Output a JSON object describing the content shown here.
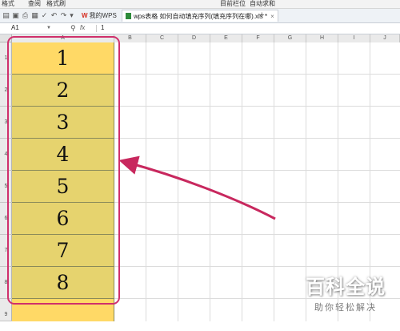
{
  "ribbon": {
    "items": [
      "格式",
      "查阅",
      "格式刷",
      "目前栏位",
      "自动求和"
    ]
  },
  "tabs": [
    {
      "label": "我的WPS",
      "active": false
    },
    {
      "label": "wps表格 如何自动填充序列(填充序列在哪).xls *",
      "active": true
    }
  ],
  "formula_bar": {
    "name_box": "A1",
    "fx_label": "fx",
    "value": "1"
  },
  "columns": [
    "A",
    "B",
    "C",
    "D",
    "E",
    "F",
    "G",
    "H",
    "I",
    "J"
  ],
  "rows": [
    "1",
    "2",
    "3",
    "4",
    "5",
    "6",
    "7",
    "8",
    "9"
  ],
  "cells": [
    "1",
    "2",
    "3",
    "4",
    "5",
    "6",
    "7",
    "8"
  ],
  "colors": {
    "active_cell": "#ffd966",
    "selected_cells": "#e6d36e",
    "highlight_outline": "#d0306c",
    "arrow": "#c8285e"
  },
  "watermark": {
    "title": "百科全说",
    "subtitle": "助你轻松解决"
  }
}
